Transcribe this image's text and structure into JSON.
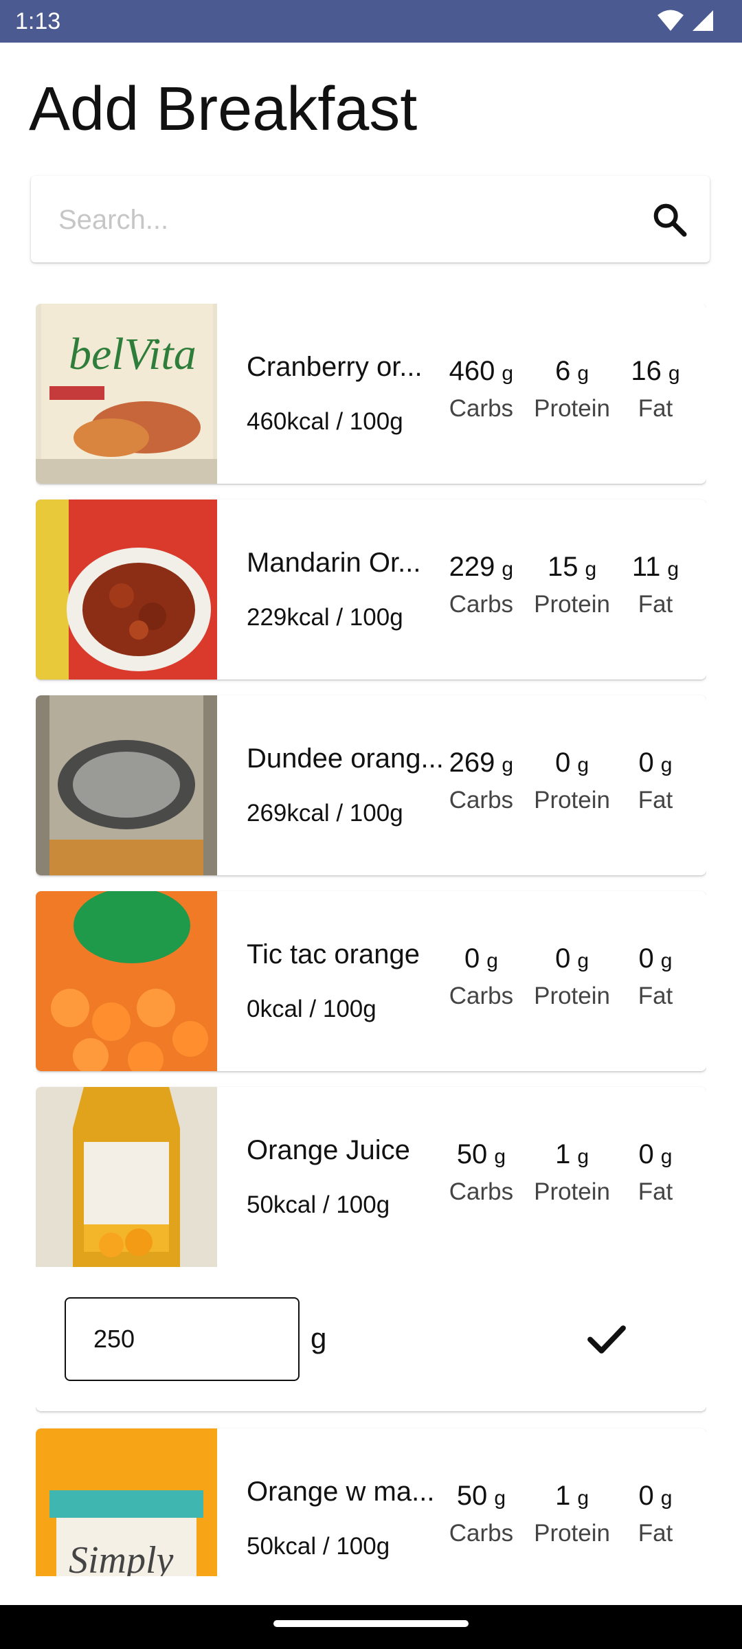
{
  "status_bar": {
    "time": "1:13"
  },
  "page": {
    "title": "Add Breakfast"
  },
  "search": {
    "placeholder": "Search..."
  },
  "labels": {
    "carbs": "Carbs",
    "protein": "Protein",
    "fat": "Fat",
    "unit": "g"
  },
  "items": [
    {
      "name": "Cranberry or...",
      "kcal": "460kcal / 100g",
      "carbs": "460",
      "protein": "6",
      "fat": "16",
      "image": "belvita-biscuits-package"
    },
    {
      "name": "Mandarin Or...",
      "kcal": "229kcal / 100g",
      "carbs": "229",
      "protein": "15",
      "fat": "11",
      "image": "mandarin-orange-chicken-package"
    },
    {
      "name": "Dundee orang...",
      "kcal": "269kcal / 100g",
      "carbs": "269",
      "protein": "0",
      "fat": "0",
      "image": "mackays-marmalade-jar"
    },
    {
      "name": "Tic tac orange",
      "kcal": "0kcal / 100g",
      "carbs": "0",
      "protein": "0",
      "fat": "0",
      "image": "tic-tac-orange-box"
    },
    {
      "name": "Orange Juice",
      "kcal": "50kcal / 100g",
      "carbs": "50",
      "protein": "1",
      "fat": "0",
      "image": "kirkland-orange-juice-bottle"
    },
    {
      "name": "Orange w ma...",
      "kcal": "50kcal / 100g",
      "carbs": "50",
      "protein": "1",
      "fat": "0",
      "image": "simply-orange-bottle"
    }
  ],
  "expanded_item": {
    "quantity": "250",
    "unit": "g"
  },
  "colors": {
    "status_bar": "#4c5a92",
    "background": "#ffffff"
  }
}
